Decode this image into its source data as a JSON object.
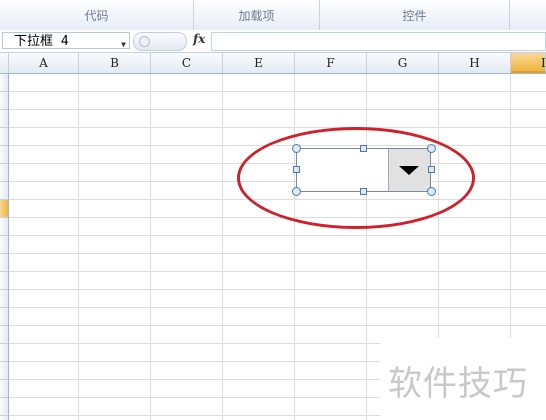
{
  "ribbon": {
    "groups": [
      {
        "label": "代码"
      },
      {
        "label": "加载项"
      },
      {
        "label": "控件"
      }
    ]
  },
  "formula_bar": {
    "name_box": "下拉框 4",
    "name_box_icon": "chevron-down-icon",
    "fx_label": "fx",
    "formula": ""
  },
  "columns": [
    "A",
    "B",
    "C",
    "E",
    "F",
    "G",
    "H",
    "I"
  ],
  "active_column": "I",
  "colors": {
    "annotation": "#d0212a",
    "active_header": "#f0b43e",
    "grid_line": "#dadcdd"
  },
  "control": {
    "type": "dropdown",
    "button_icon": "triangle-down-icon"
  },
  "watermark": "软件技巧"
}
